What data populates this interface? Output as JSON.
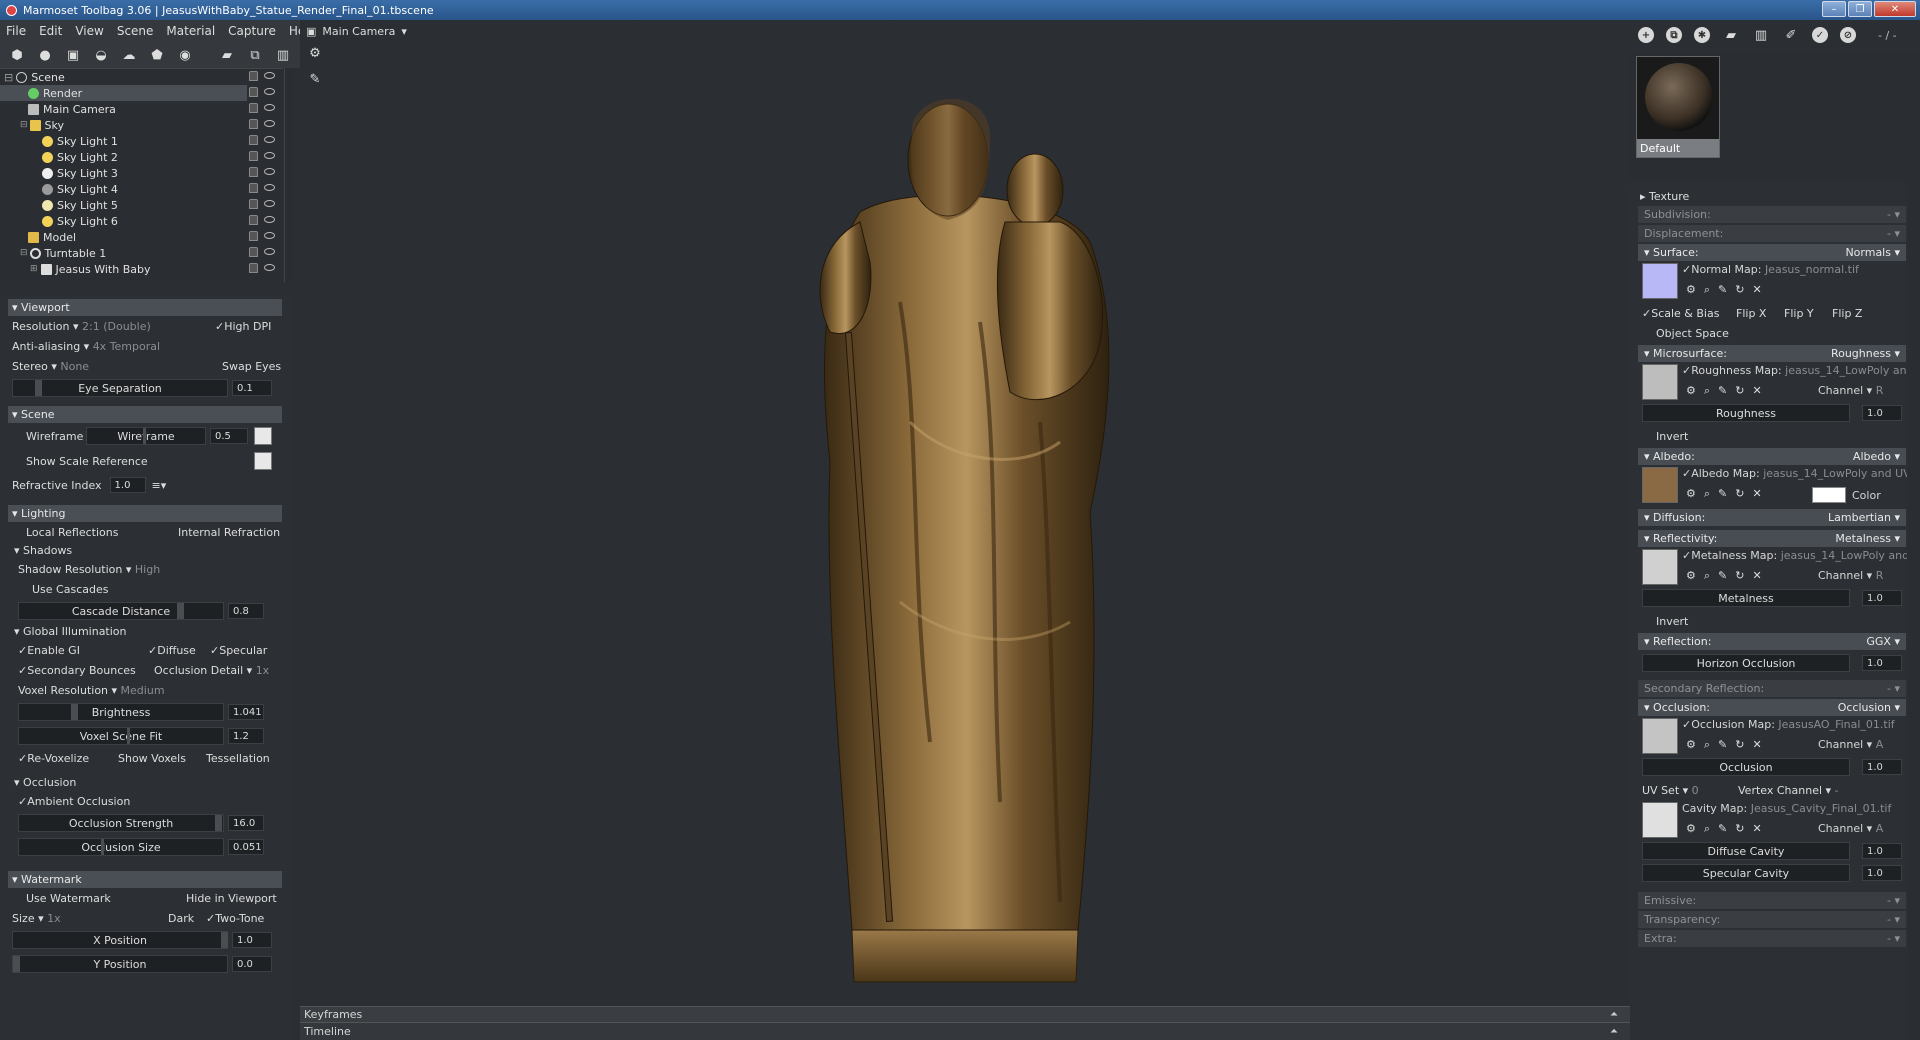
{
  "window": {
    "title": "Marmoset Toolbag 3.06  |  JeasusWithBaby_Statue_Render_Final_01.tbscene",
    "buttons": [
      "–",
      "❐",
      "✕"
    ]
  },
  "menu": [
    "File",
    "Edit",
    "View",
    "Scene",
    "Material",
    "Capture",
    "Help"
  ],
  "scene_tree": [
    {
      "label": "Scene",
      "indent": 0,
      "icon": "scene-icon"
    },
    {
      "label": "Render",
      "indent": 1,
      "icon": "render-icon",
      "selected": true
    },
    {
      "label": "Main Camera",
      "indent": 1,
      "icon": "camera-icon"
    },
    {
      "label": "Sky",
      "indent": 1,
      "icon": "sky-icon"
    },
    {
      "label": "Sky Light 1",
      "indent": 2,
      "icon": "light-icon"
    },
    {
      "label": "Sky Light 2",
      "indent": 2,
      "icon": "light-icon"
    },
    {
      "label": "Sky Light 3",
      "indent": 2,
      "icon": "light-icon"
    },
    {
      "label": "Sky Light 4",
      "indent": 2,
      "icon": "light-icon"
    },
    {
      "label": "Sky Light 5",
      "indent": 2,
      "icon": "light-icon"
    },
    {
      "label": "Sky Light 6",
      "indent": 2,
      "icon": "light-icon"
    },
    {
      "label": "Model",
      "indent": 1,
      "icon": "folder-icon"
    },
    {
      "label": "Turntable 1",
      "indent": 1,
      "icon": "turntable-icon"
    },
    {
      "label": "Jeasus With Baby",
      "indent": 2,
      "icon": "mesh-icon"
    }
  ],
  "viewport_panel": {
    "title": "Viewport",
    "resolution_label": "Resolution",
    "resolution_value": "2:1 (Double)",
    "high_dpi": "High DPI",
    "aa_label": "Anti-aliasing",
    "aa_value": "4x Temporal",
    "stereo_label": "Stereo",
    "stereo_value": "None",
    "swap_eyes": "Swap Eyes",
    "eye_sep_label": "Eye Separation",
    "eye_sep_value": "0.1"
  },
  "scene_panel": {
    "title": "Scene",
    "wireframe": "Wireframe",
    "wireframe_slider": "Wireframe",
    "wireframe_value": "0.5",
    "scale_ref": "Show Scale Reference",
    "refr_label": "Refractive Index",
    "refr_value": "1.0"
  },
  "lighting_panel": {
    "title": "Lighting",
    "local_refl": "Local Reflections",
    "internal_refr": "Internal Refraction",
    "shadows": "Shadows",
    "shadow_res_label": "Shadow Resolution",
    "shadow_res_value": "High",
    "use_cascades": "Use Cascades",
    "cascade_label": "Cascade Distance",
    "cascade_value": "0.8",
    "gi": "Global Illumination",
    "enable_gi": "Enable GI",
    "diffuse": "Diffuse",
    "specular": "Specular",
    "secondary": "Secondary Bounces",
    "occ_detail_label": "Occlusion Detail",
    "occ_detail_value": "1x",
    "voxel_res_label": "Voxel Resolution",
    "voxel_res_value": "Medium",
    "brightness_label": "Brightness",
    "brightness_value": "1.041",
    "voxel_fit_label": "Voxel Scene Fit",
    "voxel_fit_value": "1.2",
    "revoxelize": "Re-Voxelize",
    "show_voxels": "Show Voxels",
    "tessellation": "Tessellation",
    "occlusion": "Occlusion",
    "ambient_occ": "Ambient Occlusion",
    "occ_strength_label": "Occlusion Strength",
    "occ_strength_value": "16.0",
    "occ_size_label": "Occlusion Size",
    "occ_size_value": "0.051"
  },
  "watermark_panel": {
    "title": "Watermark",
    "use": "Use Watermark",
    "hide": "Hide in Viewport",
    "size_label": "Size",
    "size_value": "1x",
    "dark": "Dark",
    "two_tone": "Two-Tone",
    "xpos_label": "X Position",
    "xpos_value": "1.0",
    "ypos_label": "Y Position",
    "ypos_value": "0.0"
  },
  "viewport": {
    "camera": "Main Camera",
    "keyframes": "Keyframes",
    "timeline": "Timeline"
  },
  "right_toolbar": {
    "counter": "- / -"
  },
  "material": {
    "name": "Default"
  },
  "material_props": {
    "texture": "Texture",
    "subdivision": "Subdivision:",
    "subdivision_v": "-",
    "displacement": "Displacement:",
    "displacement_v": "-",
    "surface": "Surface:",
    "surface_v": "Normals",
    "normal_map": "Normal Map:",
    "normal_file": "Jeasus_normal.tif",
    "scale_bias": "Scale & Bias",
    "flip_x": "Flip X",
    "flip_y": "Flip Y",
    "flip_z": "Flip Z",
    "object_space": "Object Space",
    "microsurface": "Microsurface:",
    "microsurface_v": "Roughness",
    "rough_map": "Roughness Map:",
    "rough_file": "jeasus_14_LowPoly and",
    "channel": "Channel",
    "channel_r": "R",
    "channel_a": "A",
    "roughness": "Roughness",
    "roughness_v": "1.0",
    "invert": "Invert",
    "albedo": "Albedo:",
    "albedo_v": "Albedo",
    "albedo_map": "Albedo Map:",
    "albedo_file": "jeasus_14_LowPoly and UV",
    "color": "Color",
    "diffusion": "Diffusion:",
    "diffusion_v": "Lambertian",
    "reflectivity": "Reflectivity:",
    "reflectivity_v": "Metalness",
    "metal_map": "Metalness Map:",
    "metal_file": "jeasus_14_LowPoly and U",
    "metalness": "Metalness",
    "metalness_v": "1.0",
    "reflection": "Reflection:",
    "reflection_v": "GGX",
    "horizon": "Horizon Occlusion",
    "horizon_v": "1.0",
    "secondary_refl": "Secondary Reflection:",
    "secondary_refl_v": "-",
    "occlusion": "Occlusion:",
    "occlusion_v": "Occlusion",
    "occ_map": "Occlusion Map:",
    "occ_file": "JeasusAO_Final_01.tif",
    "occ_slider": "Occlusion",
    "occ_slider_v": "1.0",
    "uv_set": "UV Set",
    "uv_set_v": "0",
    "vertex_channel": "Vertex Channel",
    "vertex_channel_v": "-",
    "cavity_map": "Cavity Map:",
    "cavity_file": "Jeasus_Cavity_Final_01.tif",
    "diffuse_cavity": "Diffuse Cavity",
    "diffuse_cavity_v": "1.0",
    "specular_cavity": "Specular Cavity",
    "specular_cavity_v": "1.0",
    "emissive": "Emissive:",
    "emissive_v": "-",
    "transparency": "Transparency:",
    "transparency_v": "-",
    "extra": "Extra:",
    "extra_v": "-"
  }
}
